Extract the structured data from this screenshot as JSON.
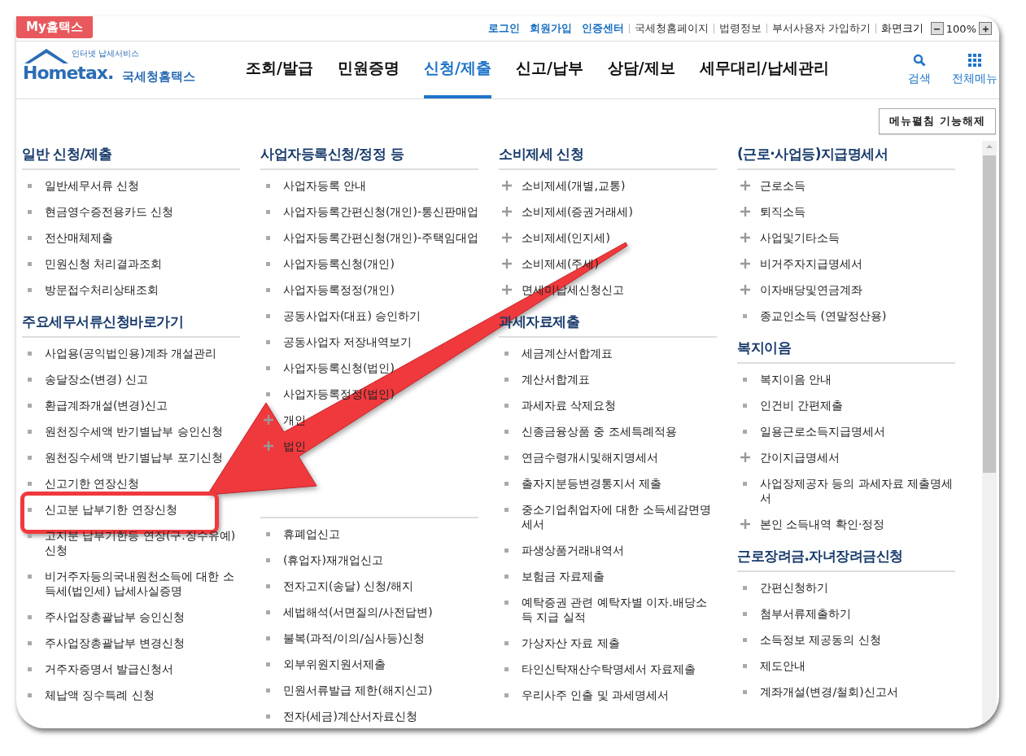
{
  "top_bar": {
    "my_tab": "My홈택스",
    "links": [
      {
        "label": "로그인",
        "kind": "primary"
      },
      {
        "label": "회원가입",
        "kind": "primary"
      },
      {
        "label": "인증센터",
        "kind": "primary"
      },
      {
        "label": "국세청홈페이지",
        "kind": "secondary"
      },
      {
        "label": "법령정보",
        "kind": "secondary"
      },
      {
        "label": "부서사용자 가입하기",
        "kind": "secondary"
      }
    ],
    "zoom_label": "화면크기",
    "zoom_value": "100%"
  },
  "logo": {
    "brand": "Hometax.",
    "tagline": "인터넷 납세서비스",
    "name": "국세청홈택스"
  },
  "nav": [
    {
      "label": "조회/발급",
      "selected": false
    },
    {
      "label": "민원증명",
      "selected": false
    },
    {
      "label": "신청/제출",
      "selected": true
    },
    {
      "label": "신고/납부",
      "selected": false
    },
    {
      "label": "상담/제보",
      "selected": false
    },
    {
      "label": "세무대리/납세관리",
      "selected": false
    }
  ],
  "tools": [
    {
      "label": "검색",
      "kind": "search"
    },
    {
      "label": "전체메뉴",
      "kind": "menu"
    }
  ],
  "menu_toggle_button": "메뉴펼침 기능해제",
  "columns": [
    {
      "sections": [
        {
          "title": "일반 신청/제출",
          "items": [
            {
              "label": "일반세무서류 신청",
              "kind": "bullet"
            },
            {
              "label": "현금영수증전용카드 신청",
              "kind": "bullet"
            },
            {
              "label": "전산매체제출",
              "kind": "bullet"
            },
            {
              "label": "민원신청 처리결과조회",
              "kind": "bullet"
            },
            {
              "label": "방문접수처리상태조회",
              "kind": "bullet"
            }
          ]
        },
        {
          "title": "주요세무서류신청바로가기",
          "items": [
            {
              "label": "사업용(공익법인용)계좌 개설관리",
              "kind": "bullet"
            },
            {
              "label": "송달장소(변경) 신고",
              "kind": "bullet"
            },
            {
              "label": "환급계좌개설(변경)신고",
              "kind": "bullet"
            },
            {
              "label": "원천징수세액 반기별납부 승인신청",
              "kind": "bullet"
            },
            {
              "label": "원천징수세액 반기별납부 포기신청",
              "kind": "bullet"
            },
            {
              "label": "신고기한 연장신청",
              "kind": "bullet"
            },
            {
              "label": "신고분 납부기한 연장신청",
              "kind": "bullet",
              "highlighted": true
            },
            {
              "label": "고지분 납부기한등 연장(구.징수유예) 신청",
              "kind": "bullet"
            },
            {
              "label": "비거주자등의국내원천소득에 대한 소득세(법인세) 납세사실증명",
              "kind": "bullet"
            },
            {
              "label": "주사업장총괄납부 승인신청",
              "kind": "bullet"
            },
            {
              "label": "주사업장총괄납부 변경신청",
              "kind": "bullet"
            },
            {
              "label": "거주자증명서 발급신청서",
              "kind": "bullet"
            },
            {
              "label": "체납액 징수특례 신청",
              "kind": "bullet"
            }
          ]
        }
      ]
    },
    {
      "sections": [
        {
          "title": "사업자등록신청/정정 등",
          "items": [
            {
              "label": "사업자등록 안내",
              "kind": "bullet"
            },
            {
              "label": "사업자등록간편신청(개인)-통신판매업",
              "kind": "bullet"
            },
            {
              "label": "사업자등록간편신청(개인)-주택임대업",
              "kind": "bullet"
            },
            {
              "label": "사업자등록신청(개인)",
              "kind": "bullet"
            },
            {
              "label": "사업자등록정정(개인)",
              "kind": "bullet"
            },
            {
              "label": "공동사업자(대표) 승인하기",
              "kind": "bullet"
            },
            {
              "label": "공동사업자 저장내역보기",
              "kind": "bullet"
            },
            {
              "label": "사업자등록신청(법인)",
              "kind": "bullet"
            },
            {
              "label": "사업자등록정정(법인)",
              "kind": "bullet"
            },
            {
              "label": "개인",
              "kind": "plus"
            },
            {
              "label": "법인",
              "kind": "plus"
            }
          ]
        },
        {
          "items": [
            {
              "label": "휴폐업신고",
              "kind": "bullet"
            },
            {
              "label": "(휴업자)재개업신고",
              "kind": "bullet"
            },
            {
              "label": "전자고지(송달) 신청/해지",
              "kind": "bullet"
            },
            {
              "label": "세법해석(서면질의/사전답변)",
              "kind": "bullet"
            },
            {
              "label": "불복(과적/이의/심사등)신청",
              "kind": "bullet"
            },
            {
              "label": "외부위원지원서제출",
              "kind": "bullet"
            },
            {
              "label": "민원서류발급 제한(해지신고)",
              "kind": "bullet"
            },
            {
              "label": "전자(세금)계산서자료신청",
              "kind": "bullet"
            }
          ]
        }
      ]
    },
    {
      "sections": [
        {
          "title": "소비제세 신청",
          "items": [
            {
              "label": "소비제세(개별,교통)",
              "kind": "plus"
            },
            {
              "label": "소비제세(증권거래세)",
              "kind": "plus"
            },
            {
              "label": "소비제세(인지세)",
              "kind": "plus"
            },
            {
              "label": "소비제세(주세)",
              "kind": "plus"
            },
            {
              "label": "면세미납세신청신고",
              "kind": "plus"
            }
          ]
        },
        {
          "title": "과세자료제출",
          "items": [
            {
              "label": "세금계산서합계표",
              "kind": "bullet"
            },
            {
              "label": "계산서합계표",
              "kind": "bullet"
            },
            {
              "label": "과세자료 삭제요청",
              "kind": "bullet"
            },
            {
              "label": "신종금융상품 중 조세특례적용",
              "kind": "bullet"
            },
            {
              "label": "연금수령개시및해지명세서",
              "kind": "bullet"
            },
            {
              "label": "출자지분등변경통지서 제출",
              "kind": "bullet"
            },
            {
              "label": "중소기업취업자에 대한 소득세감면명세서",
              "kind": "bullet"
            },
            {
              "label": "파생상품거래내역서",
              "kind": "bullet"
            },
            {
              "label": "보험금 자료제출",
              "kind": "bullet"
            },
            {
              "label": "예탁증권 관련 예탁자별 이자.배당소득 지급 실적",
              "kind": "bullet"
            },
            {
              "label": "가상자산 자료 제출",
              "kind": "bullet"
            },
            {
              "label": "타인신탁재산수탁명세서 자료제출",
              "kind": "bullet"
            },
            {
              "label": "우리사주 인출 및 과세명세서",
              "kind": "bullet"
            }
          ]
        }
      ]
    },
    {
      "sections": [
        {
          "title": "(근로·사업등)지급명세서",
          "items": [
            {
              "label": "근로소득",
              "kind": "plus"
            },
            {
              "label": "퇴직소득",
              "kind": "plus"
            },
            {
              "label": "사업및기타소득",
              "kind": "plus"
            },
            {
              "label": "비거주자지급명세서",
              "kind": "plus"
            },
            {
              "label": "이자배당및연금계좌",
              "kind": "plus"
            },
            {
              "label": "종교인소득 (연말정산용)",
              "kind": "bullet"
            }
          ]
        },
        {
          "title": "복지이음",
          "items": [
            {
              "label": "복지이음 안내",
              "kind": "bullet"
            },
            {
              "label": "인건비 간편제출",
              "kind": "bullet"
            },
            {
              "label": "일용근로소득지급명세서",
              "kind": "bullet"
            },
            {
              "label": "간이지급명세서",
              "kind": "plus"
            },
            {
              "label": "사업장제공자 등의 과세자료 제출명세서",
              "kind": "bullet"
            },
            {
              "label": "본인 소득내역 확인·정정",
              "kind": "plus"
            }
          ]
        },
        {
          "title": "근로장려금.자녀장려금신청",
          "items": [
            {
              "label": "간편신청하기",
              "kind": "bullet"
            },
            {
              "label": "첨부서류제출하기",
              "kind": "bullet"
            },
            {
              "label": "소득정보 제공동의 신청",
              "kind": "bullet"
            },
            {
              "label": "제도안내",
              "kind": "bullet"
            },
            {
              "label": "계좌개설(변경/철회)신고서",
              "kind": "bullet"
            }
          ]
        }
      ]
    }
  ]
}
